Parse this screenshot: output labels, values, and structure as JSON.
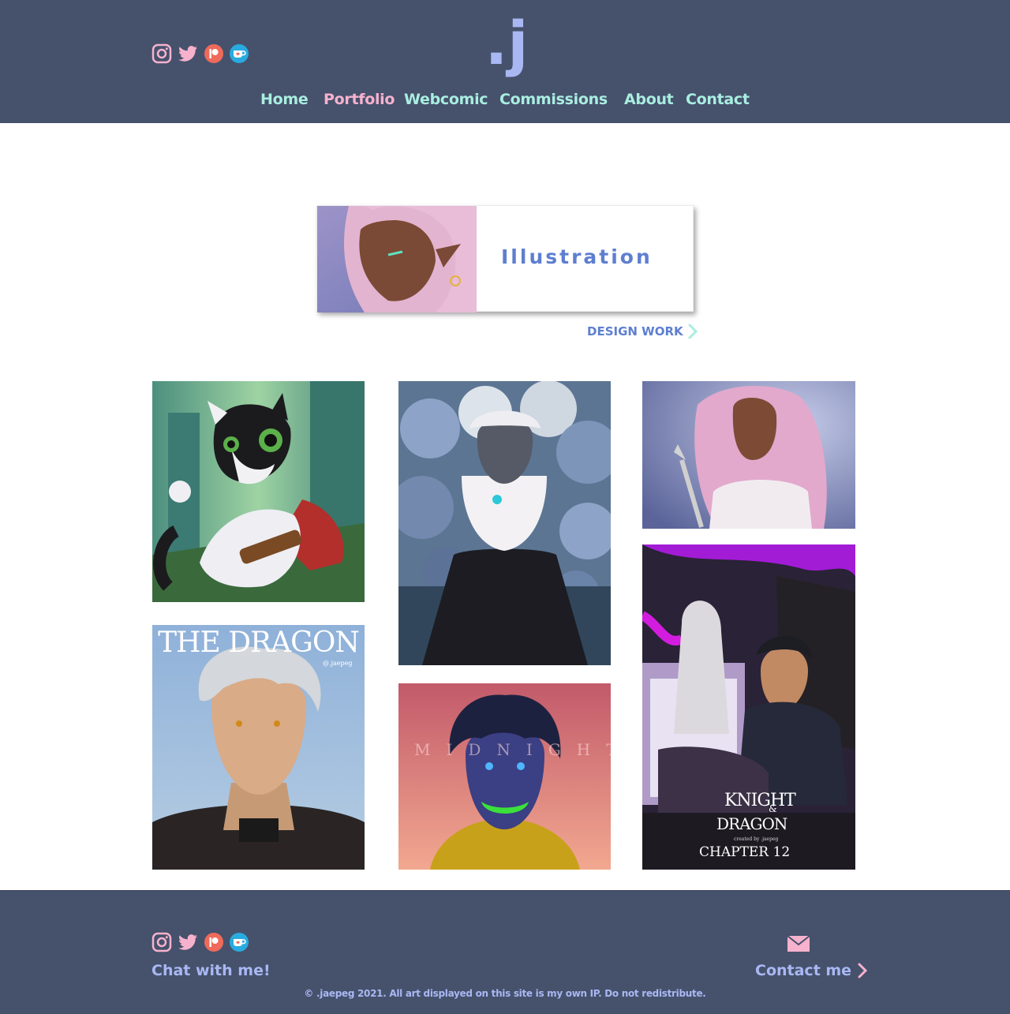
{
  "header": {
    "logo": ".j",
    "social_icons": [
      "instagram-icon",
      "twitter-icon",
      "patreon-icon",
      "kofi-icon"
    ],
    "nav": [
      {
        "label": "Home",
        "active": false
      },
      {
        "label": "Portfolio",
        "active": true
      },
      {
        "label": "Webcomic",
        "active": false
      },
      {
        "label": "Commissions",
        "active": false
      },
      {
        "label": "About",
        "active": false
      },
      {
        "label": "Contact",
        "active": false
      }
    ]
  },
  "category": {
    "title": "Illustration",
    "next_label": "DESIGN WORK"
  },
  "gallery": {
    "dragon_title": "THE DRAGON",
    "dragon_credit": "@.jaepeg",
    "midnight_title": "MIDNIGHT",
    "knight_title_1": "KNIGHT",
    "knight_amp": "&",
    "knight_title_2": "DRAGON",
    "knight_created": "created by .jaepeg",
    "knight_chapter": "CHAPTER 12"
  },
  "footer": {
    "social_icons": [
      "instagram-icon",
      "twitter-icon",
      "patreon-icon",
      "kofi-icon"
    ],
    "chat_label": "Chat with me!",
    "contact_label": "Contact me",
    "copyright": "© .jaepeg 2021. All art displayed on this site is my own IP. Do not redistribute."
  },
  "colors": {
    "header_bg": "#46516c",
    "nav_text": "#a9eee0",
    "nav_active": "#f6b2cd",
    "accent_blue": "#5e7fd0",
    "logo": "#a9b8f3"
  }
}
